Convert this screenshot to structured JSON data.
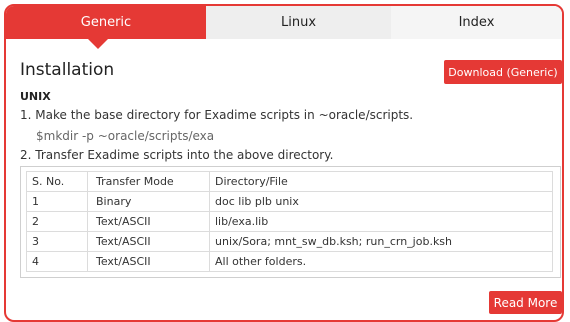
{
  "tabs": [
    {
      "label": "Generic",
      "active": true
    },
    {
      "label": "Linux",
      "active": false
    },
    {
      "label": "Index",
      "active": false
    }
  ],
  "section_title": "Installation",
  "download_button": "Download (Generic)",
  "subheading": "UNIX",
  "steps": [
    "1. Make the base directory for Exadime scripts in ~oracle/scripts.",
    "2. Transfer Exadime scripts into the above directory."
  ],
  "command": "$mkdir -p ~oracle/scripts/exa",
  "table": {
    "headers": [
      "S. No.",
      "Transfer Mode",
      "Directory/File"
    ],
    "rows": [
      [
        "1",
        "Binary",
        "doc lib plb unix"
      ],
      [
        "2",
        "Text/ASCII",
        "lib/exa.lib"
      ],
      [
        "3",
        "Text/ASCII",
        "unix/Sora; mnt_sw_db.ksh; run_crn_job.ksh"
      ],
      [
        "4",
        "Text/ASCII",
        "All other folders."
      ]
    ]
  },
  "read_more_button": "Read More",
  "colors": {
    "accent": "#e53935",
    "tab_inactive": "#eeeeee",
    "text": "#333333"
  }
}
